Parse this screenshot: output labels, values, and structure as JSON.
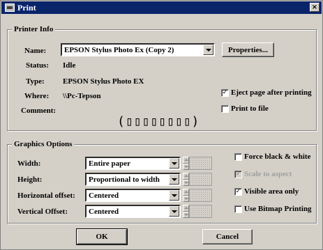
{
  "window": {
    "title": "Print",
    "close_label": "×"
  },
  "printer_info": {
    "legend": "Printer Info",
    "name_label": "Name:",
    "name_value": "EPSON Stylus Photo Ex (Copy 2)",
    "properties_label": "Properties...",
    "status_label": "Status:",
    "status_value": "Idle",
    "type_label": "Type:",
    "type_value": "EPSON Stylus Photo EX",
    "where_label": "Where:",
    "where_value": "\\\\Pc-Tepson",
    "comment_label": "Comment:",
    "comment_value": "(▯▯▯▯▯▯▯▯)",
    "eject_label": "Eject page after printing",
    "eject_checked": "✓",
    "print_to_file_label": "Print to file",
    "print_to_file_checked": ""
  },
  "graphics_options": {
    "legend": "Graphics Options",
    "width_label": "Width:",
    "width_value": "Entire paper",
    "height_label": "Height:",
    "height_value": "Proportional to width",
    "hoffset_label": "Horizontal offset:",
    "hoffset_value": "Centered",
    "voffset_label": "Vertical Offset:",
    "voffset_value": "Centered",
    "force_bw_label": "Force black & white",
    "force_bw_checked": "",
    "scale_label": "Scale to aspect",
    "scale_checked": "✓",
    "visible_label": "Visible area only",
    "visible_checked": "✓",
    "bitmap_label": "Use Bitmap Printing",
    "bitmap_checked": ""
  },
  "buttons": {
    "ok": "OK",
    "cancel": "Cancel"
  }
}
